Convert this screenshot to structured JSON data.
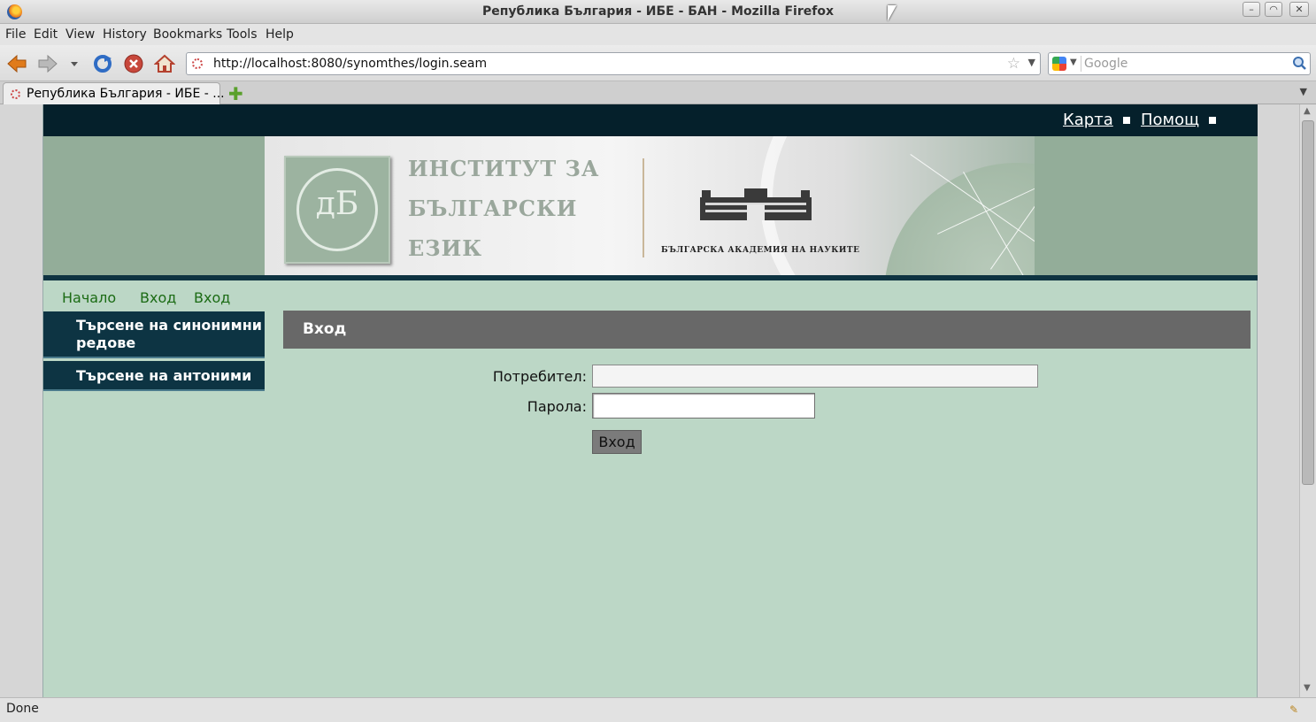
{
  "window": {
    "title": "Република България - ИБЕ - БАН - Mozilla Firefox",
    "controls": {
      "minimize": "–",
      "maximize": "◠",
      "close": "✕"
    }
  },
  "menubar": {
    "items": [
      "File",
      "Edit",
      "View",
      "History",
      "Bookmarks",
      "Tools",
      "Help"
    ]
  },
  "toolbar": {
    "url": "http://localhost:8080/synomthes/login.seam",
    "search_placeholder": "Google",
    "icons": [
      "back-arrow-icon",
      "forward-arrow-icon",
      "reload-icon",
      "stop-icon",
      "home-icon",
      "bookmark-star-icon",
      "search-magnifier-icon"
    ]
  },
  "tabs": {
    "active_title": "Република България - ИБЕ - ...",
    "new_tab": "✚",
    "list": "▼"
  },
  "site": {
    "top_links": [
      "Карта",
      "Помощ"
    ],
    "banner": {
      "institute_lines": [
        "ИНСТИТУТ ЗА",
        "БЪЛГАРСКИ",
        "ЕЗИК"
      ],
      "seal_mark": "дБ",
      "academy": "БЪЛГАРСКА АКАДЕМИЯ НА НАУКИТЕ"
    },
    "breadcrumbs": [
      "Начало",
      "Вход",
      "Вход"
    ],
    "sidebar": [
      "Търсене на синонимни редове",
      "Търсене на антоними"
    ],
    "panel_title": "Вход",
    "form": {
      "user_label": "Потребител:",
      "user_value": "",
      "password_label": "Парола:",
      "password_value": "",
      "submit_label": "Вход"
    }
  },
  "status": {
    "text": "Done"
  },
  "colors": {
    "page_bg": "#bcd7c6",
    "top_band": "#05202b",
    "banner_bg": "#93ad99",
    "sidebar_bg": "#0d3443",
    "panel_head": "#686868",
    "breadcrumb": "#1b6b14"
  }
}
